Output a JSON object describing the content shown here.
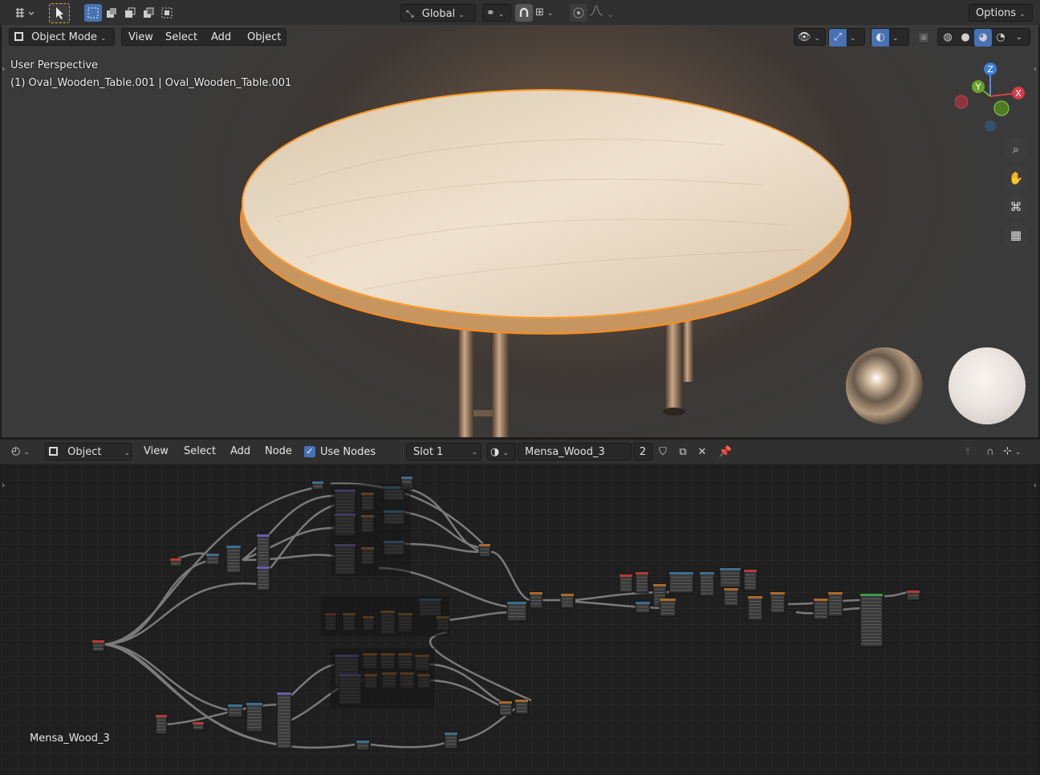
{
  "topbar": {
    "transform_orientation": "Global",
    "options_label": "Options"
  },
  "viewport_header": {
    "mode_label": "Object Mode",
    "menus": [
      "View",
      "Select",
      "Add",
      "Object"
    ]
  },
  "viewport": {
    "view_name": "User Perspective",
    "object_info": "(1) Oval_Wooden_Table.001 | Oval_Wooden_Table.001",
    "gizmo_axes": {
      "z": "Z",
      "y": "Y",
      "x": "X"
    }
  },
  "node_header": {
    "editor_type_label": "Object",
    "menus": [
      "View",
      "Select",
      "Add",
      "Node"
    ],
    "use_nodes_label": "Use Nodes",
    "use_nodes_checked": true,
    "slot_label": "Slot 1",
    "material_name": "Mensa_Wood_3",
    "user_count": "2"
  },
  "node_editor": {
    "material_label": "Mensa_Wood_3"
  },
  "colors": {
    "accent": "#4772b3",
    "selection_outline": "#ff8c1a",
    "header_bg": "#303030"
  }
}
